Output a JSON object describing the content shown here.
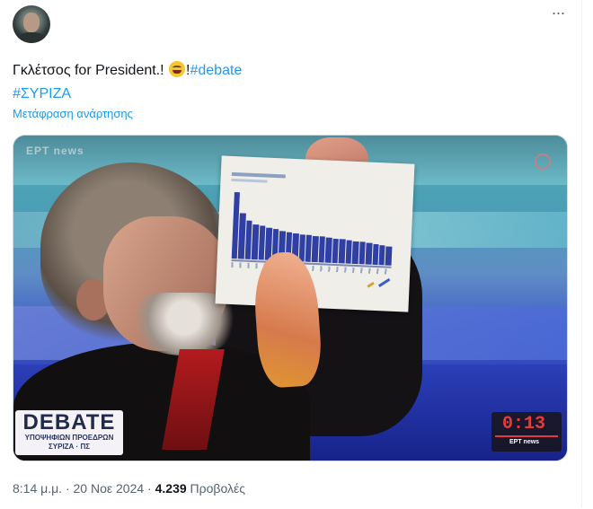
{
  "tweet": {
    "text_line1_prefix": "Γκλέτσος for President.!",
    "text_line1_suffix": "!",
    "hashtag1": "#debate",
    "hashtag2": "#ΣΥΡΙΖΑ",
    "emoji": "grinning-face",
    "translate_label": "Μετάφραση ανάρτησης",
    "more_icon": "more-icon",
    "more_label": "···"
  },
  "media": {
    "channel_logo": "ΕΡΤ news",
    "overlay": {
      "title": "DEBATE",
      "subtitle1": "ΥΠΟΨΗΦΙΩΝ ΠΡΟΕΔΡΩΝ",
      "subtitle2": "ΣΥΡΙΖΑ · ΠΣ"
    },
    "timer": "0:13",
    "timer_network": "ΕΡΤ news",
    "colors": {
      "timer": "#e43b3b",
      "overlay_text": "#202a4a",
      "paper_bars": "#2f3fa3"
    },
    "paper_chart_values": [
      90,
      62,
      52,
      48,
      46,
      44,
      42,
      40,
      39,
      38,
      37,
      36,
      35,
      35,
      34,
      33,
      33,
      32,
      31,
      30,
      29,
      28,
      27,
      26
    ]
  },
  "meta": {
    "time": "8:14 μ.μ.",
    "separator": " · ",
    "date": "20 Νοε 2024",
    "views_count": "4.239",
    "views_label": "Προβολές"
  },
  "colors": {
    "link": "#1d9bf0",
    "secondary": "#536471",
    "text": "#0f1419"
  }
}
